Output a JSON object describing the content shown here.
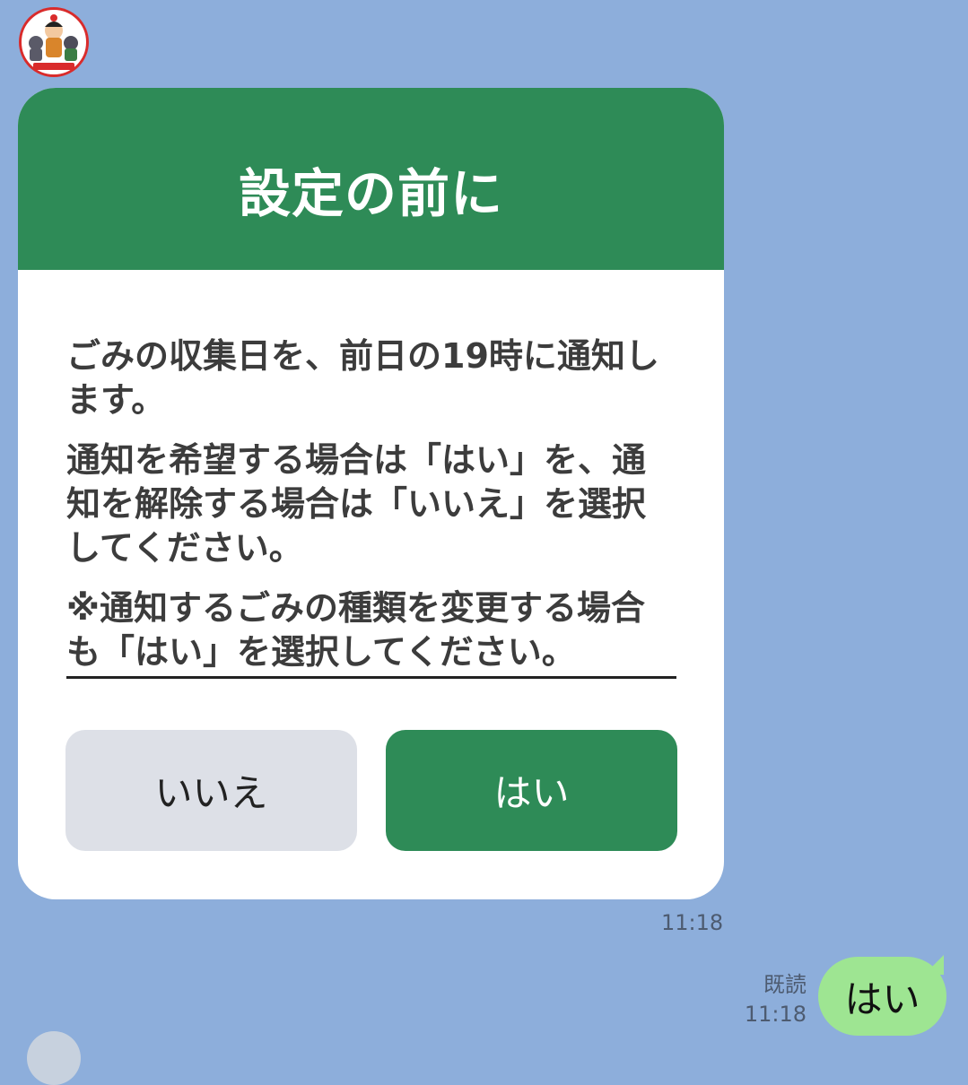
{
  "chat": {
    "avatar_icon": "bot-avatar-icon",
    "card": {
      "title": "設定の前に",
      "paragraph1": "ごみの収集日を、前日の19時に通知します。",
      "paragraph2": "通知を希望する場合は「はい」を、通知を解除する場合は「いいえ」を選択してください。",
      "note": "※通知するごみの種類を変更する場合も「はい」を選択してください。",
      "buttons": {
        "no_label": "いいえ",
        "yes_label": "はい"
      }
    },
    "incoming_time": "11:18",
    "outgoing": {
      "read_label": "既読",
      "time": "11:18",
      "message": "はい"
    }
  },
  "colors": {
    "background": "#8daedb",
    "card_header": "#2e8b57",
    "yes_button": "#2e8b57",
    "no_button": "#dde0e7",
    "outgoing_bubble": "#9ee592"
  }
}
